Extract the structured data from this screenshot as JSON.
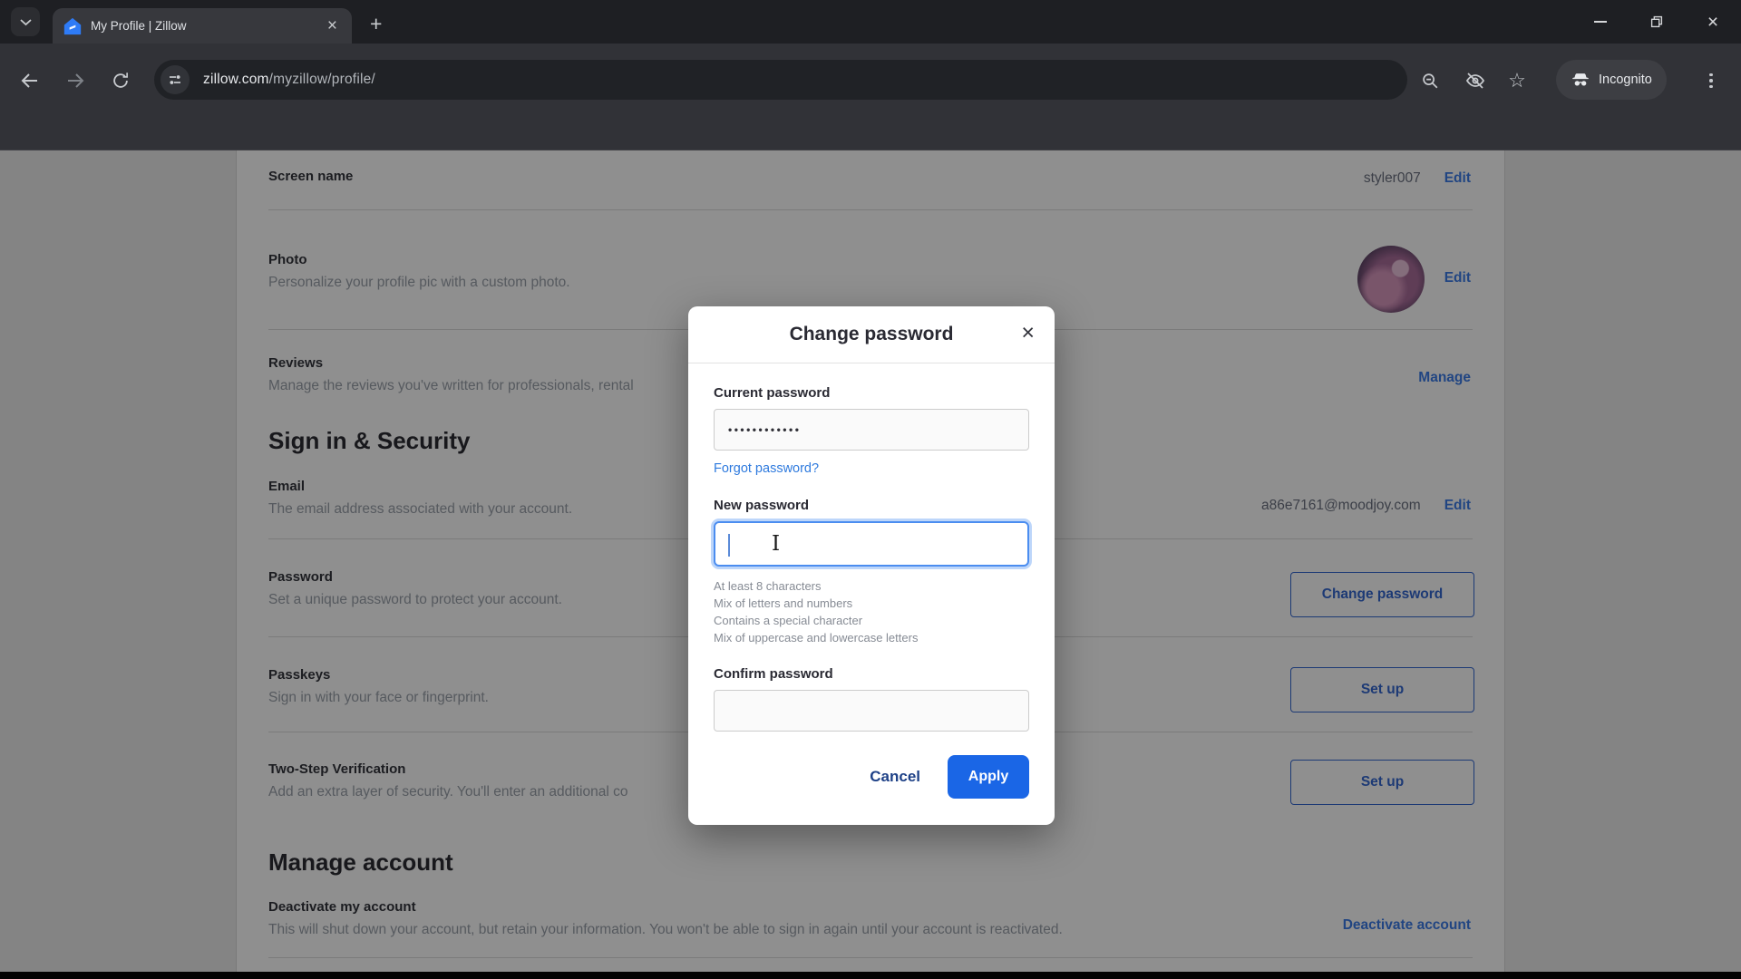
{
  "browser": {
    "tab_title": "My Profile | Zillow",
    "url": {
      "domain": "zillow.com",
      "path": "/myzillow/profile/"
    },
    "incognito_label": "Incognito",
    "glyphs": {
      "new_tab": "+",
      "tab_close": "×",
      "window_close": "×",
      "star": "☆",
      "modal_close": "×"
    }
  },
  "page": {
    "screen_name": {
      "label": "Screen name",
      "value": "styler007",
      "action": "Edit"
    },
    "photo": {
      "label": "Photo",
      "desc": "Personalize your profile pic with a custom photo.",
      "action": "Edit"
    },
    "reviews": {
      "label": "Reviews",
      "desc": "Manage the reviews you've written for professionals, rental",
      "action": "Manage"
    },
    "sign_in_heading": "Sign in & Security",
    "email": {
      "label": "Email",
      "desc": "The email address associated with your account.",
      "value": "a86e7161@moodjoy.com",
      "action": "Edit"
    },
    "password": {
      "label": "Password",
      "desc": "Set a unique password to protect your account.",
      "action": "Change password"
    },
    "passkeys": {
      "label": "Passkeys",
      "desc": "Sign in with your face or fingerprint.",
      "action": "Set up"
    },
    "two_step": {
      "label": "Two-Step Verification",
      "desc": "Add an extra layer of security. You'll enter an additional co",
      "action": "Set up"
    },
    "manage_heading": "Manage account",
    "deactivate": {
      "label": "Deactivate my account",
      "desc": "This will shut down your account, but retain your information. You won't be able to sign in again until your account is reactivated.",
      "action": "Deactivate account"
    }
  },
  "modal": {
    "title": "Change password",
    "current_password": {
      "label": "Current password",
      "masked_value": "••••••••••••"
    },
    "forgot_link": "Forgot password?",
    "new_password_label": "New password",
    "requirements": [
      "At least 8 characters",
      "Mix of letters and numbers",
      "Contains a special character",
      "Mix of uppercase and lowercase letters"
    ],
    "confirm_password_label": "Confirm password",
    "cancel_label": "Cancel",
    "apply_label": "Apply"
  },
  "colors": {
    "zillow_link_blue": "#3c7ce8",
    "outlined_button_blue": "#3568d0",
    "apply_blue": "#1a66e6",
    "forgot_link_blue": "#2e7ade",
    "cancel_navy": "#1e4187",
    "focus_ring_blue": "#4b8df0"
  }
}
